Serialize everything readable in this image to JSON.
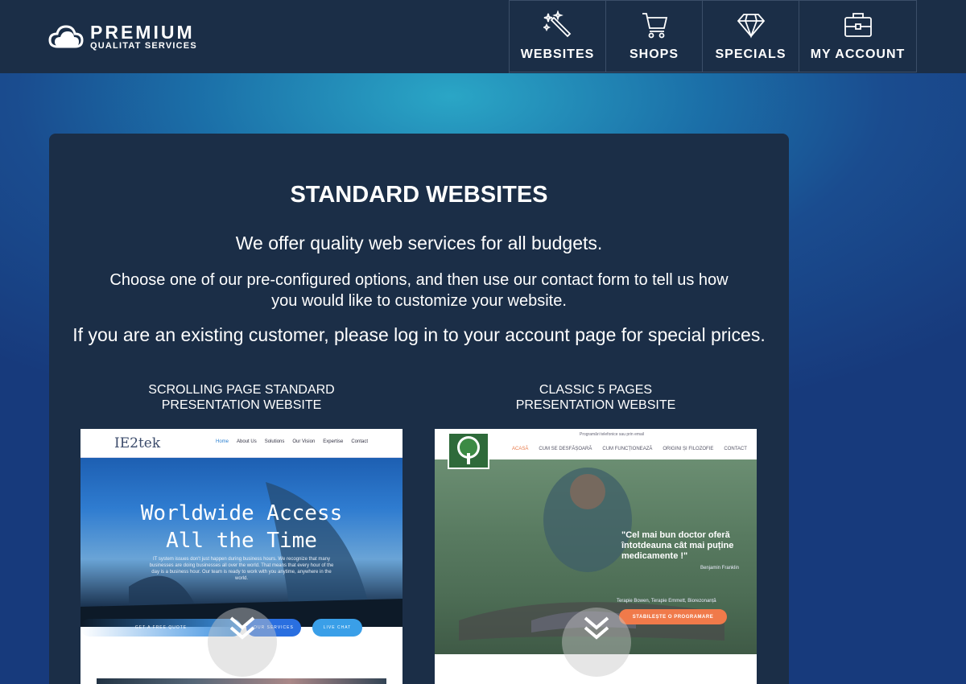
{
  "header": {
    "logo_main": "PREMIUM",
    "logo_sub": "QUALITAT SERVICES",
    "nav": [
      {
        "label": "WEBSITES",
        "icon": "magic-wand-icon"
      },
      {
        "label": "SHOPS",
        "icon": "cart-icon"
      },
      {
        "label": "SPECIALS",
        "icon": "diamond-icon"
      },
      {
        "label": "MY ACCOUNT",
        "icon": "briefcase-icon"
      }
    ]
  },
  "main": {
    "title": "STANDARD WEBSITES",
    "intro": "We offer quality web services for all budgets.",
    "instructions": "Choose one of our pre-configured options, and then use our contact form to tell us how you would like to customize your website.",
    "existing": "If you are an existing customer, please log in to your account page for special prices.",
    "cards": [
      {
        "title_line1": "SCROLLING PAGE STANDARD",
        "title_line2": "PRESENTATION WEBSITE",
        "preview": {
          "logo": "IE2tek",
          "links": [
            "Home",
            "About Us",
            "Solutions",
            "Our Vision",
            "Expertise",
            "Contact"
          ],
          "headline_line1": "Worldwide Access",
          "headline_line2": "All the Time",
          "body": "IT system issues don't just happen during business hours. We recognize that many businesses are doing businesses all over the world. That means that every hour of the day is a business hour. Our team is ready to work with you anytime, anywhere in the world.",
          "btn_quote": "GET A FREE QUOTE",
          "btn_services": "OUR SERVICES",
          "btn_chat": "LIVE CHAT"
        }
      },
      {
        "title_line1": "CLASSIC 5 PAGES",
        "title_line2": "PRESENTATION WEBSITE",
        "preview": {
          "top": "Programări telefonice sau prin email",
          "links": [
            "ACASĂ",
            "CUM SE DESFĂȘOARĂ",
            "CUM FUNCȚIONEAZĂ",
            "ORIGINI ȘI FILOZOFIE",
            "CONTACT"
          ],
          "quote": "\"Cel mai bun doctor oferă întotdeauna cât mai puține medicamente !\"",
          "author": "Benjamin Franklin",
          "sub": "Terapie Bowen, Terapie Emmett, Biorezonanță",
          "btn": "STABILEȘTE O PROGRAMARE"
        }
      }
    ]
  },
  "colors": {
    "header_bg": "#1b2e47",
    "accent_orange": "#f07a4a",
    "accent_blue": "#2a7fd0"
  }
}
